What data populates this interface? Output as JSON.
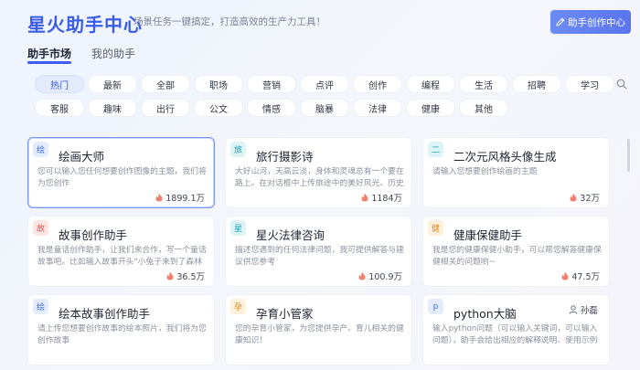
{
  "header": {
    "title": "星火助手中心",
    "subtitle": "场景任务一键搞定，打造高效的生产力工具！",
    "create_button": "助手创作中心"
  },
  "tabs": [
    {
      "label": "助手市场",
      "active": true
    },
    {
      "label": "我的助手",
      "active": false
    }
  ],
  "categories": [
    "热门",
    "最新",
    "全部",
    "职场",
    "营销",
    "点评",
    "创作",
    "编程",
    "生活",
    "招聘",
    "学习",
    "客服",
    "趣味",
    "出行",
    "公文",
    "情感",
    "脑暴",
    "法律",
    "健康",
    "其他"
  ],
  "active_category": "热门",
  "cards": [
    {
      "icon": "绘",
      "icon_color": "#3b6fe0",
      "icon_bg": "#e4ecfd",
      "title": "绘画大师",
      "desc": "您可以输入您任何想要创作图像的主题，我们将为您创作",
      "count": "1899.1万",
      "selected": true
    },
    {
      "icon": "旅",
      "icon_color": "#1aa0b5",
      "icon_bg": "#def3f6",
      "title": "旅行摄影诗",
      "desc": "大好山河，天高云淡，身体和灵魂总有一个要在路上。在对话框中上传旅途中的美好风光、历史古迹",
      "count": "1184万"
    },
    {
      "icon": "二",
      "icon_color": "#1aa0b5",
      "icon_bg": "#def3f6",
      "title": "二次元风格头像生成",
      "desc": "请输入您想要创作绘画的主题",
      "count": "32万"
    },
    {
      "icon": "故",
      "icon_color": "#e0524a",
      "icon_bg": "#fde6e3",
      "title": "故事创作助手",
      "desc": "我是童话创作助手，让我们来合作，写一个童话故事吧。比如输入故事开头\"小兔子来到了森林里\"",
      "count": "36.5万"
    },
    {
      "icon": "星",
      "icon_color": "#1aa0b5",
      "icon_bg": "#def3f6",
      "title": "星火法律咨询",
      "desc": "描述您遇到的任何法律问题，我可提供解答与建议供您参考",
      "count": "100.9万"
    },
    {
      "icon": "健",
      "icon_color": "#d98a1e",
      "icon_bg": "#fdf0dc",
      "title": "健康保健助手",
      "desc": "我是您的健康保健小助手，可以帮您解答健康保健相关的问题哟~",
      "count": "47.5万"
    },
    {
      "icon": "绘",
      "icon_color": "#3b6fe0",
      "icon_bg": "#e4ecfd",
      "title": "绘本故事创作助手",
      "desc": "请上传您想要创作故事的绘本照片，我们将为您创作故事"
    },
    {
      "icon": "孕",
      "icon_color": "#d98a1e",
      "icon_bg": "#fdf0dc",
      "title": "孕育小管家",
      "desc": "您的孕育小管家，为您提供孕产、育儿相关的健康知识！"
    },
    {
      "icon": "p",
      "icon_color": "#3b6fe0",
      "icon_bg": "#e4ecfd",
      "title": "python大脑",
      "desc": "输入python问题（可以输入关键词，可以输入问题），助手会给出相应的解释说明、使用示例和",
      "author": "孙磊"
    }
  ],
  "colors": {
    "accent": "#3a5ce6",
    "fire": "#f2806e"
  }
}
